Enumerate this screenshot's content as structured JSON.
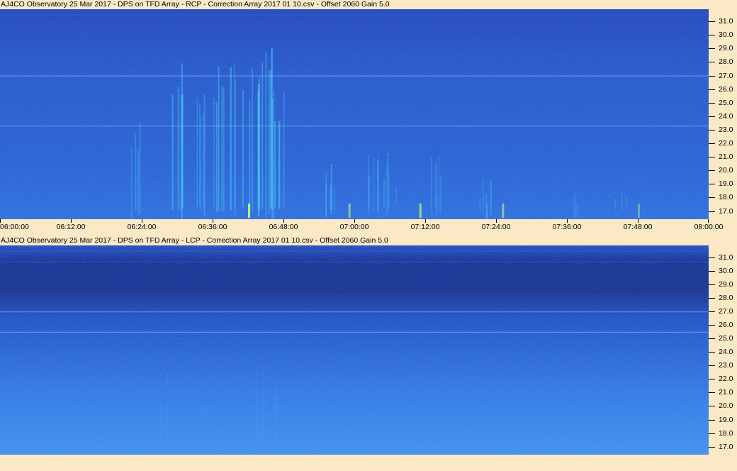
{
  "chart_data": [
    {
      "type": "heatmap",
      "title": "AJ4CO Observatory 25 Mar 2017  -  DPS on TFD Array  -  RCP  -  Correction Array 2017 01 10.csv  -  Offset 2060  Gain 5.0",
      "polarization": "RCP",
      "y_ticks": [
        "31.0",
        "30.0",
        "29.0",
        "28.0",
        "27.0",
        "26.0",
        "25.0",
        "24.0",
        "23.0",
        "22.0",
        "21.0",
        "20.0",
        "19.0",
        "18.0",
        "17.0"
      ],
      "x_ticks": [
        "06:00:00",
        "06:12:00",
        "06:24:00",
        "06:36:00",
        "06:48:00",
        "07:00:00",
        "07:12:00",
        "07:24:00",
        "07:36:00",
        "07:48:00",
        "08:00:00"
      ],
      "xlim": [
        "06:00:00",
        "08:00:00"
      ],
      "ylim": [
        16.4,
        31.9
      ],
      "colors": {
        "background": "#1e56cc",
        "burst": "#4fe6ff",
        "peak": "#c8ff70"
      }
    },
    {
      "type": "heatmap",
      "title": "AJ4CO Observatory 25 Mar 2017  -  DPS on TFD Array  -  LCP  -  Correction Array 2017 01 10.csv  -  Offset 2060  Gain 5.0",
      "polarization": "LCP",
      "y_ticks": [
        "31.0",
        "30.0",
        "29.0",
        "28.0",
        "27.0",
        "26.0",
        "25.0",
        "24.0",
        "23.0",
        "22.0",
        "21.0",
        "20.0",
        "19.0",
        "18.0",
        "17.0"
      ],
      "xlim": [
        "06:00:00",
        "08:00:00"
      ],
      "ylim": [
        16.4,
        31.9
      ],
      "colors": {
        "background": "#1c50c8",
        "dark_band": "#0b1f7a",
        "bottom": "#3a8cee"
      }
    }
  ],
  "colors": {
    "frame": "#fbe9c6"
  }
}
